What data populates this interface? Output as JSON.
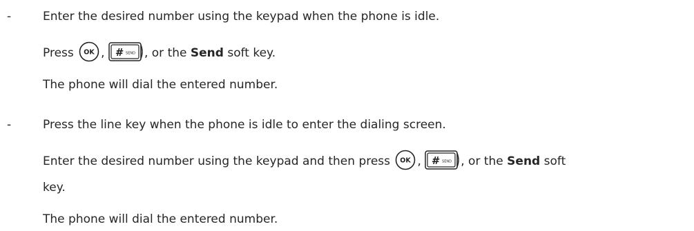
{
  "bullet_marker": "-",
  "items": [
    {
      "main": "Enter the desired number using the keypad when the phone is idle.",
      "press_prefix": "Press",
      "sep": ",",
      "or_text": ", or the",
      "send_bold": "Send",
      "soft_key": "soft key.",
      "result": "The phone will dial the entered number."
    },
    {
      "main": "Press the line key when the phone is idle to enter the dialing screen.",
      "press_prefix": "Enter the desired number using the keypad and then press",
      "sep": ",",
      "or_text": ", or the",
      "send_bold": "Send",
      "soft_key": "soft",
      "soft_key_wrap": "key.",
      "result": "The phone will dial the entered number."
    }
  ],
  "keys": {
    "ok_label": "OK",
    "hash_label": "#",
    "send_small_label": "SEND"
  }
}
